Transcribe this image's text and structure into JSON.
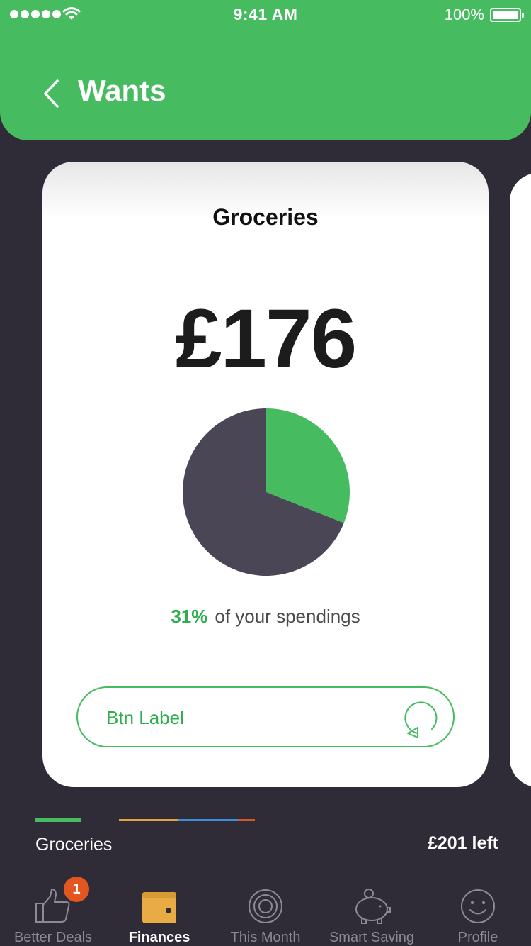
{
  "status_bar": {
    "time": "9:41 AM",
    "battery_percent": "100%",
    "signal_icon": "signal-dots-icon",
    "wifi_icon": "wifi-icon",
    "battery_icon": "battery-icon"
  },
  "header": {
    "title": "Wants",
    "back_icon": "chevron-left-icon",
    "background_color": "#46bb5f"
  },
  "card": {
    "title": "Groceries",
    "amount": "£176",
    "percent": "31%",
    "percent_suffix": "of your spendings",
    "button_label": "Btn Label",
    "button_icon": "refresh-icon"
  },
  "chart_data": {
    "type": "pie",
    "slices": [
      {
        "value": 31,
        "color": "#46bb5f"
      },
      {
        "value": 69,
        "color": "#4a4656"
      }
    ]
  },
  "budget": {
    "category": "Groceries",
    "left": "£201 left",
    "bar_colors": [
      "#e3a23b",
      "#3d8fd6",
      "#d9532b"
    ]
  },
  "tabs": [
    {
      "label": "Better Deals",
      "icon": "thumbs-up-icon",
      "badge": "1",
      "active": false
    },
    {
      "label": "Finances",
      "icon": "wallet-icon",
      "active": true
    },
    {
      "label": "This Month",
      "icon": "target-icon",
      "active": false
    },
    {
      "label": "Smart Saving",
      "icon": "piggy-bank-icon",
      "active": false
    },
    {
      "label": "Profile",
      "icon": "smiley-icon",
      "active": false
    }
  ],
  "colors": {
    "accent": "#46bb5f",
    "background": "#2f2c38",
    "badge": "#e4561f"
  }
}
